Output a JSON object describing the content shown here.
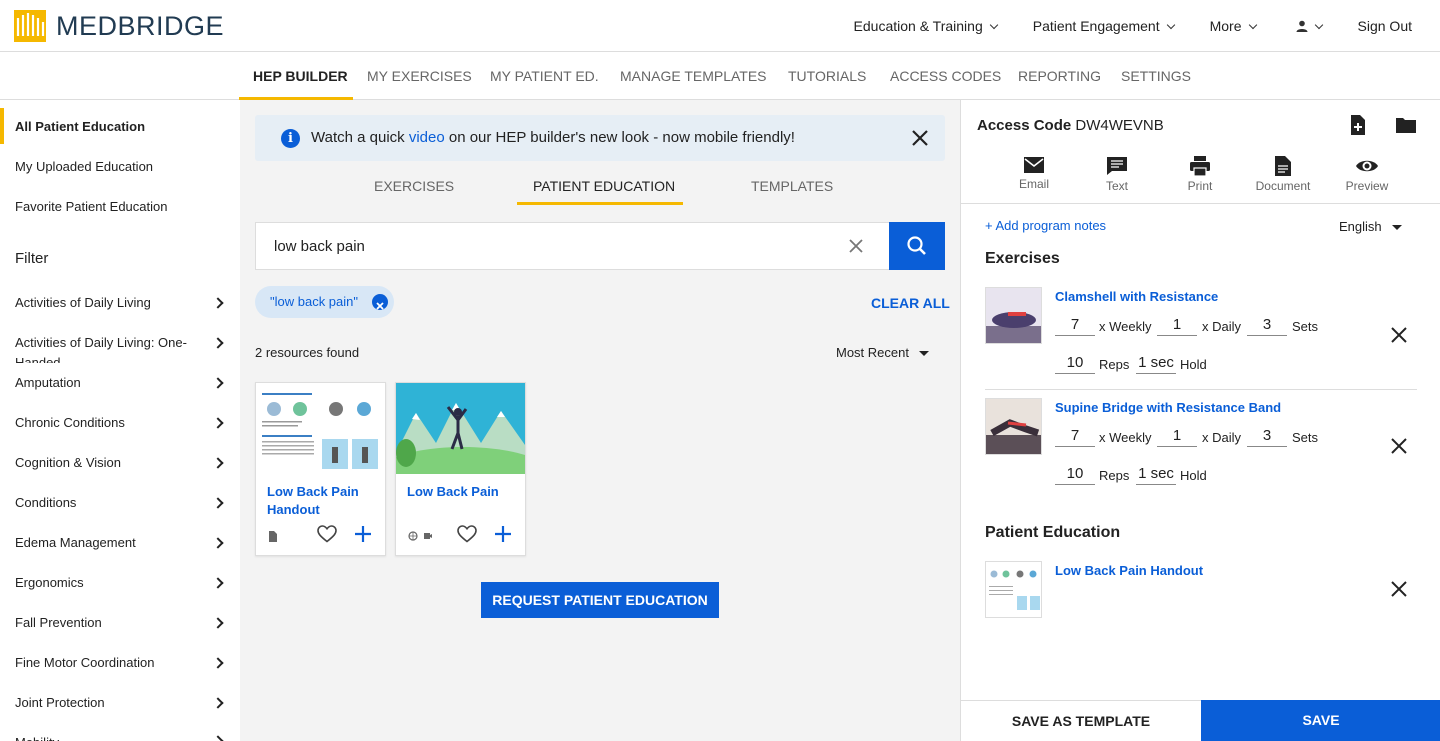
{
  "header": {
    "brand": "MEDBRIDGE",
    "nav": [
      {
        "label": "Education & Training"
      },
      {
        "label": "Patient Engagement"
      },
      {
        "label": "More"
      }
    ],
    "sign_out": "Sign Out"
  },
  "tabs": [
    "HEP BUILDER",
    "MY EXERCISES",
    "MY PATIENT ED.",
    "MANAGE TEMPLATES",
    "TUTORIALS",
    "ACCESS CODES",
    "REPORTING",
    "SETTINGS"
  ],
  "sidebar": {
    "items": [
      "All Patient Education",
      "My Uploaded Education",
      "Favorite Patient Education"
    ],
    "filter_title": "Filter",
    "filters": [
      "Activities of Daily Living",
      "Activities of Daily Living: One-Handed",
      "Amputation",
      "Chronic Conditions",
      "Cognition & Vision",
      "Conditions",
      "Edema Management",
      "Ergonomics",
      "Fall Prevention",
      "Fine Motor Coordination",
      "Joint Protection",
      "Mobility"
    ]
  },
  "banner": {
    "before": "Watch a quick ",
    "link": "video",
    "after": " on our HEP builder's new look - now mobile friendly!"
  },
  "subtabs": [
    "EXERCISES",
    "PATIENT EDUCATION",
    "TEMPLATES"
  ],
  "search": {
    "value": "low back pain"
  },
  "chip": "\"low back pain\"",
  "clear_all": "CLEAR ALL",
  "found": "2 resources found",
  "sort": "Most Recent",
  "cards": [
    {
      "title": "Low Back Pain Handout"
    },
    {
      "title": "Low Back Pain"
    }
  ],
  "request_btn": "REQUEST PATIENT EDUCATION",
  "right": {
    "access_label": "Access Code",
    "access_code": "DW4WEVNB",
    "actions": [
      "Email",
      "Text",
      "Print",
      "Document",
      "Preview"
    ],
    "notes": "+ Add program notes",
    "language": "English",
    "exercises_title": "Exercises",
    "exercises": [
      {
        "name": "Clamshell with Resistance",
        "weekly": "7",
        "daily": "1",
        "sets": "3",
        "reps": "10",
        "hold": "1 sec"
      },
      {
        "name": "Supine Bridge with Resistance Band",
        "weekly": "7",
        "daily": "1",
        "sets": "3",
        "reps": "10",
        "hold": "1 sec"
      }
    ],
    "labels": {
      "weekly": "x Weekly",
      "daily": "x Daily",
      "sets": "Sets",
      "reps": "Reps",
      "hold": "Hold"
    },
    "pe_title": "Patient Education",
    "pe_items": [
      {
        "name": "Low Back Pain Handout"
      }
    ],
    "save_template": "SAVE AS TEMPLATE",
    "save": "SAVE"
  },
  "colors": {
    "accent": "#0a5ed7",
    "highlight": "#f5b800"
  }
}
